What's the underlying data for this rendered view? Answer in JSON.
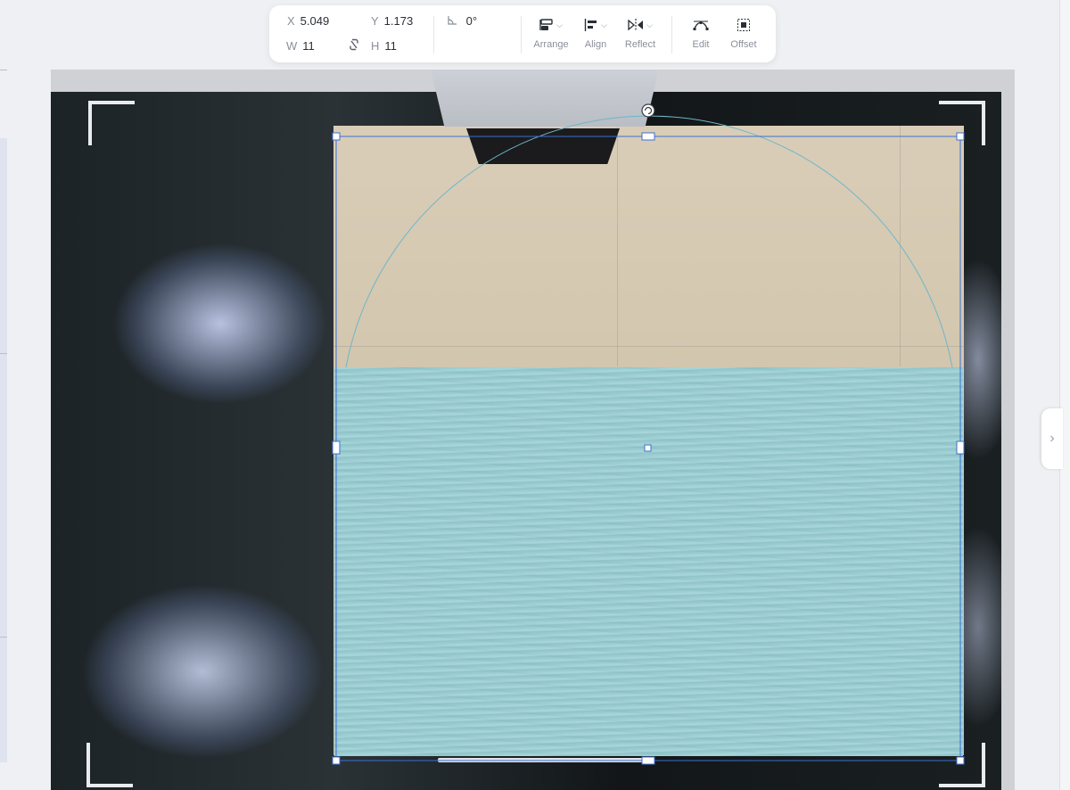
{
  "toolbar": {
    "x_label": "X",
    "x_value": "5.049",
    "y_label": "Y",
    "y_value": "1.173",
    "w_label": "W",
    "w_value": "11",
    "h_label": "H",
    "h_value": "11",
    "rotation": "0°",
    "arrange_label": "Arrange",
    "align_label": "Align",
    "reflect_label": "Reflect",
    "edit_label": "Edit",
    "offset_label": "Offset"
  },
  "colors": {
    "selection": "#3b6fd1",
    "fill_preview": "#9ccfd4"
  }
}
